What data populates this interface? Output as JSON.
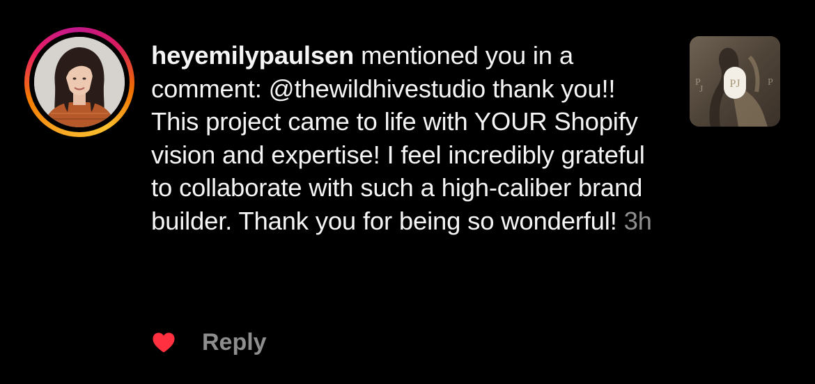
{
  "notification": {
    "username": "heyemilypaulsen",
    "action_text": " mentioned you in a comment: ",
    "mention": "@thewildhivestudio",
    "comment_text": " thank you!! This project came to life with YOUR Shopify vision and expertise! I feel incredibly grateful to collaborate with such a high-caliber brand builder. Thank you for being so wonderful! ",
    "timestamp": "3h",
    "reply_label": "Reply",
    "liked": true,
    "thumbnail_monogram": "PJ"
  },
  "colors": {
    "background": "#000000",
    "text": "#f5f5f5",
    "muted": "#8e8e8e",
    "like": "#ff3040"
  },
  "icons": {
    "like": "heart-icon"
  }
}
